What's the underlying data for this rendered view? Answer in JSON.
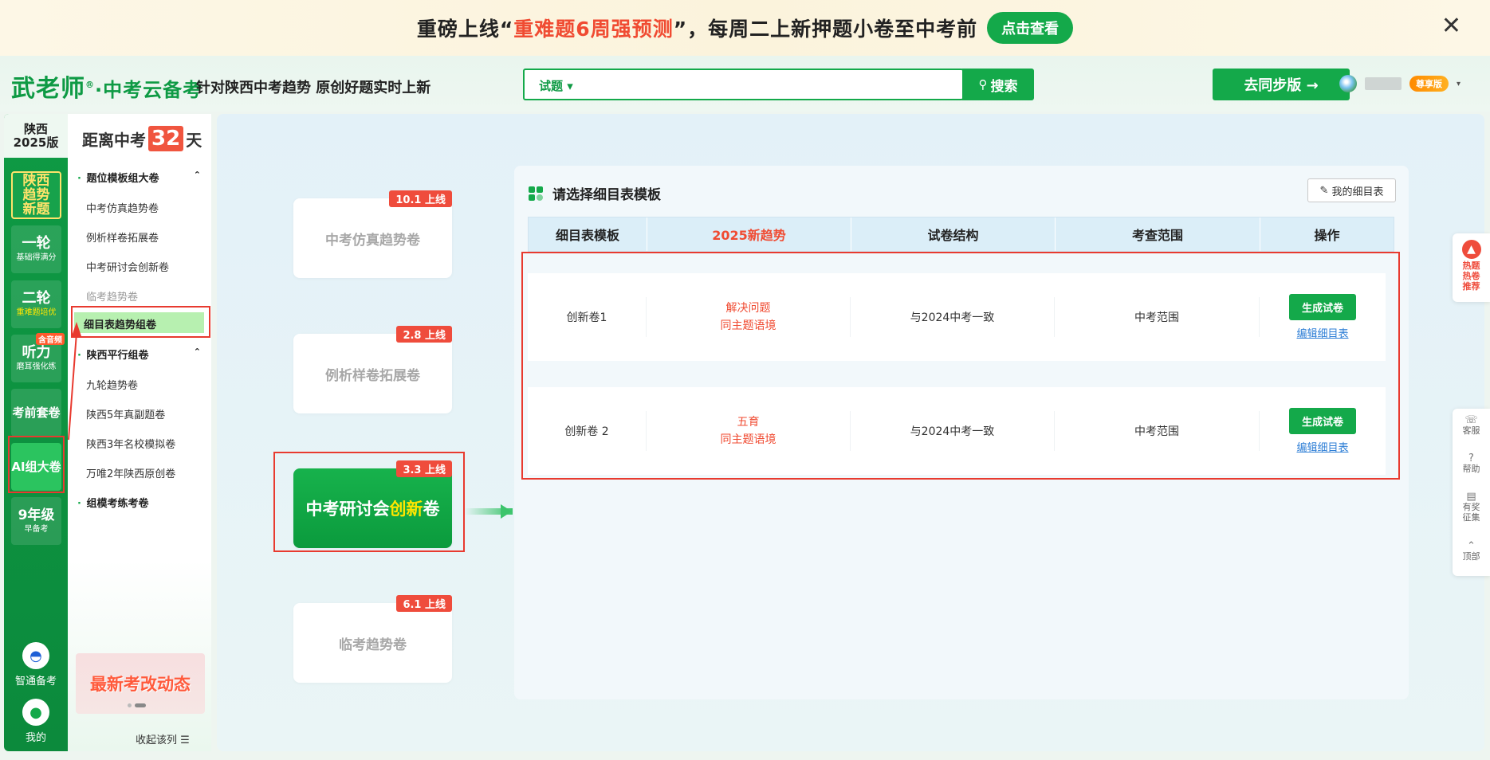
{
  "banner": {
    "text_prefix": "重磅上线“",
    "text_highlight": "重难题6周强预测",
    "text_suffix": "”，每周二上新押题小卷至中考前",
    "button": "点击查看",
    "close": "✕"
  },
  "header": {
    "logo_main": "武老师",
    "logo_mark": "®",
    "logo_sub": "·中考云备考",
    "slogan": "针对陕西中考趋势 原创好题实时上新",
    "search_type": "试题 ▾",
    "search_button": "搜索",
    "sync_button": "去同步版 →",
    "vip_badge": "尊享版",
    "caret": "▾"
  },
  "leftnav": {
    "edition_line1": "陕西",
    "edition_line2": "2025版",
    "items": [
      {
        "big": "陕西\n趋势\n新题",
        "small": ""
      },
      {
        "big": "一轮",
        "small": "基础得满分"
      },
      {
        "big": "二轮",
        "small": "重难题培优"
      },
      {
        "big": "听力",
        "small": "磨耳强化练",
        "tag": "含音频"
      },
      {
        "big": "考前套卷",
        "small": ""
      },
      {
        "big": "AI组大卷",
        "small": ""
      },
      {
        "big": "9年级",
        "small": "早备考"
      }
    ],
    "bottom": [
      {
        "label": "智通备考",
        "icon": "◓"
      },
      {
        "label": "我的",
        "icon": "●"
      }
    ]
  },
  "submenu": {
    "countdown_prefix": "距离中考",
    "countdown_num": "32",
    "countdown_suffix": "天",
    "groups": [
      {
        "label": "题位模板组大卷",
        "caret": "⌃"
      },
      {
        "label": "陕西平行组卷",
        "caret": "⌃"
      },
      {
        "label": "组模考练考卷",
        "caret": ""
      }
    ],
    "items": [
      "中考仿真趋势卷",
      "例析样卷拓展卷",
      "中考研讨会创新卷",
      "临考趋势卷",
      "细目表趋势组卷",
      "九轮趋势卷",
      "陕西5年真副题卷",
      "陕西3年名校模拟卷",
      "万唯2年陕西原创卷"
    ],
    "promo": "最新考改动态",
    "collapse": "收起该列 ☰"
  },
  "cards": [
    {
      "title": "中考仿真趋势卷",
      "date": "10.1 上线"
    },
    {
      "title": "例析样卷拓展卷",
      "date": "2.8 上线"
    },
    {
      "title_a": "中考研讨会",
      "title_b": "创新",
      "title_c": "卷",
      "date": "3.3 上线"
    },
    {
      "title": "临考趋势卷",
      "date": "6.1 上线"
    }
  ],
  "panel": {
    "title": "请选择细目表模板",
    "my_button": "我的细目表",
    "columns": [
      "细目表模板",
      "2025新趋势",
      "试卷结构",
      "考查范围",
      "操作"
    ],
    "rows": [
      {
        "name": "创新卷1",
        "trend1": "解决问题",
        "trend2": "同主题语境",
        "structure": "与2024中考一致",
        "scope": "中考范围",
        "generate": "生成试卷",
        "edit": "编辑细目表"
      },
      {
        "name": "创新卷 2",
        "trend1": "五育",
        "trend2": "同主题语境",
        "structure": "与2024中考一致",
        "scope": "中考范围",
        "generate": "生成试卷",
        "edit": "编辑细目表"
      }
    ]
  },
  "right_tools": {
    "hot": "热题\n热卷\n推荐",
    "items": [
      {
        "label": "客服",
        "icon": "☏"
      },
      {
        "label": "帮助",
        "icon": "?"
      },
      {
        "label": "有奖\n征集",
        "icon": "▤"
      },
      {
        "label": "顶部",
        "icon": "⌃"
      }
    ]
  },
  "colors": {
    "brand_green": "#14a94a",
    "accent_red": "#f04b32",
    "highlight_yellow": "#ffe600"
  }
}
